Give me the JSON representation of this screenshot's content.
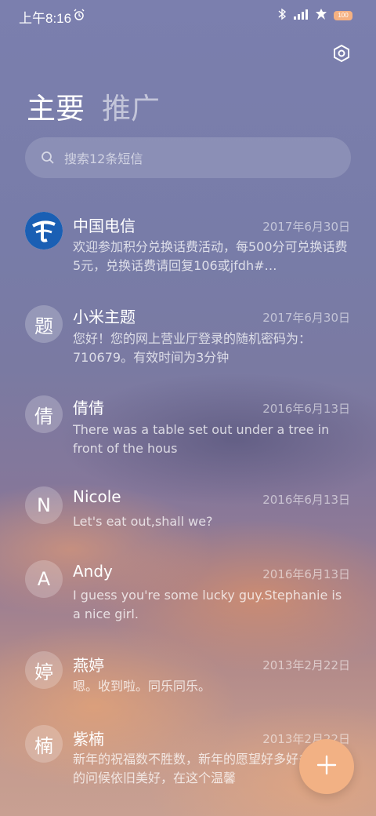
{
  "status": {
    "time": "上午8:16",
    "battery": "100",
    "icons": [
      "alarm-icon",
      "bluetooth-icon",
      "signal-icon",
      "leaf-icon",
      "battery-icon"
    ]
  },
  "tabs": [
    {
      "label": "主要",
      "active": true
    },
    {
      "label": "推广",
      "active": false
    }
  ],
  "search": {
    "placeholder": "搜索12条短信"
  },
  "messages": [
    {
      "avatar": "logo",
      "name": "中国电信",
      "date": "2017年6月30日",
      "preview": "欢迎参加积分兑换话费活动，每500分可兑换话费5元，兑换话费请回复106或jfdh#…"
    },
    {
      "avatar": "题",
      "name": "小米主题",
      "date": "2017年6月30日",
      "preview": "您好！您的网上营业厅登录的随机密码为：710679。有效时间为3分钟"
    },
    {
      "avatar": "倩",
      "name": "倩倩",
      "date": "2016年6月13日",
      "preview": "There was a table set out under a tree in front of the hous"
    },
    {
      "avatar": "N",
      "name": "Nicole",
      "date": "2016年6月13日",
      "preview": "Let's eat out,shall we?"
    },
    {
      "avatar": "A",
      "name": "Andy",
      "date": "2016年6月13日",
      "preview": "I guess you're some lucky guy.Stephanie is a nice girl."
    },
    {
      "avatar": "婷",
      "name": "燕婷",
      "date": "2013年2月22日",
      "preview": "嗯。收到啦。同乐同乐。"
    },
    {
      "avatar": "楠",
      "name": "紫楠",
      "date": "2013年2月22日",
      "preview": "新年的祝福数不胜数，新年的愿望好多好多，新年的问候依旧美好，在这个温馨"
    }
  ],
  "colors": {
    "fab": "#f2b184",
    "brand_blue": "#1a5fb4"
  }
}
